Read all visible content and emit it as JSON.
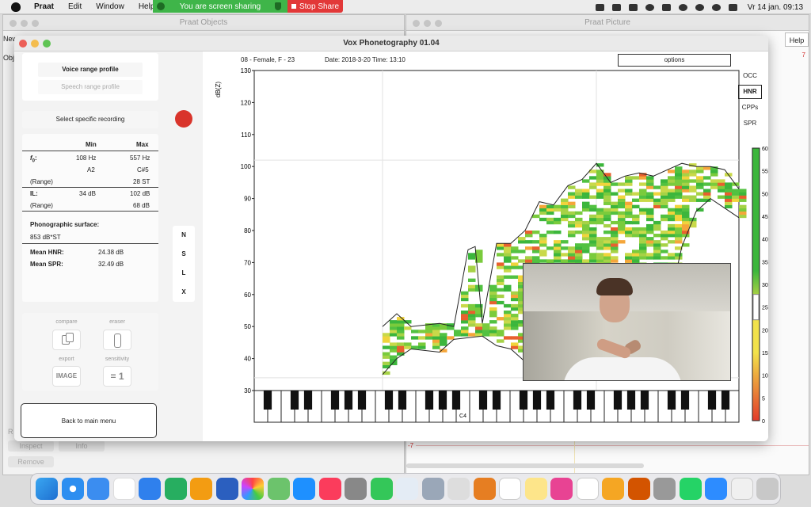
{
  "menubar": {
    "app": "Praat",
    "items": [
      "Edit",
      "Window",
      "Help"
    ],
    "clock": "Vr 14 jan.  09:13"
  },
  "share": {
    "status": "You are screen sharing",
    "stop": "Stop Share"
  },
  "bg_windows": {
    "objects_title": "Praat Objects",
    "picture_title": "Praat Picture",
    "new_label": "New",
    "obj_label": "Obj",
    "help_button": "Help",
    "inspect_button": "Inspect",
    "info_button": "Info",
    "remove_button": "Remove",
    "axis_top": "7",
    "axis_bottom": "-7",
    "partial_label": "R"
  },
  "window": {
    "title": "Vox Phonetography 01.04"
  },
  "left": {
    "voice_range": "Voice range profile",
    "speech_range": "Speech range profile",
    "select_recording": "Select specific recording",
    "table": {
      "col_min": "Min",
      "col_max": "Max",
      "f0_label": "f",
      "f0_sub": "0",
      "f0_colon": ":",
      "f0_min": "108 Hz",
      "f0_max": "557 Hz",
      "note_min": "A2",
      "note_max": "C#5",
      "range_label": "(Range)",
      "f0_range": "28 ST",
      "il_label": "IL:",
      "il_min": "34 dB",
      "il_max": "102 dB",
      "il_range": "68 dB",
      "surface_label": "Phonographic surface:",
      "surface_value": "853 dB*ST",
      "hnr_label": "Mean HNR:",
      "hnr_value": "24.38 dB",
      "spr_label": "Mean SPR:",
      "spr_value": "32.49 dB"
    },
    "tools": {
      "compare": "compare",
      "eraser": "eraser",
      "export": "export",
      "export_value": "IMAGE",
      "sensitivity": "sensitivity",
      "sensitivity_value": "= 1"
    },
    "back": "Back to main menu"
  },
  "modes": [
    "N",
    "S",
    "L",
    "X"
  ],
  "chart_header": {
    "subject": "08  -  Female, F  -  23",
    "date": "Date: 2018-3-20 Time: 13:10",
    "options": "options"
  },
  "metric_buttons": [
    "OCC",
    "HNR",
    "CPPs",
    "SPR"
  ],
  "selected_metric": "HNR",
  "colors": {
    "record": "#d9342b",
    "green": "#3cb63c",
    "yellow": "#f2e24a",
    "red": "#e23b2b"
  },
  "chart_data": {
    "type": "heatmap",
    "ylabel": "dB(Z)",
    "yticks": [
      30,
      40,
      50,
      60,
      70,
      80,
      90,
      100,
      110,
      120,
      130
    ],
    "ylim": [
      30,
      130
    ],
    "xlim_semitones": [
      -12,
      22
    ],
    "piano_label": "C4",
    "upper_contour": [
      [
        -3,
        50
      ],
      [
        -2,
        54
      ],
      [
        -1,
        50
      ],
      [
        1,
        51
      ],
      [
        2,
        50
      ],
      [
        3,
        74
      ],
      [
        3.5,
        75
      ],
      [
        4,
        51
      ],
      [
        5,
        76
      ],
      [
        6,
        76
      ],
      [
        7,
        80
      ],
      [
        8,
        89
      ],
      [
        9,
        88
      ],
      [
        10,
        94
      ],
      [
        11,
        96
      ],
      [
        12,
        101
      ],
      [
        13,
        95
      ],
      [
        14,
        97
      ],
      [
        15,
        98
      ],
      [
        16,
        97
      ],
      [
        17,
        99
      ],
      [
        18,
        101
      ],
      [
        19,
        100
      ],
      [
        20,
        100
      ],
      [
        21,
        99
      ],
      [
        22,
        93
      ]
    ],
    "lower_contour": [
      [
        -3,
        35
      ],
      [
        -2,
        40
      ],
      [
        -1,
        43
      ],
      [
        1,
        42
      ],
      [
        2,
        46
      ],
      [
        4,
        47
      ],
      [
        5,
        44
      ],
      [
        6,
        43
      ],
      [
        7,
        39
      ],
      [
        8,
        37
      ],
      [
        9,
        41
      ],
      [
        10,
        45
      ],
      [
        11,
        47
      ],
      [
        12,
        49
      ],
      [
        13,
        48
      ],
      [
        14,
        46
      ],
      [
        15,
        45
      ],
      [
        16,
        46
      ],
      [
        17,
        55
      ],
      [
        18,
        75
      ],
      [
        19,
        86
      ],
      [
        20,
        90
      ],
      [
        21,
        87
      ],
      [
        22,
        84
      ]
    ],
    "colorbar": {
      "min": 0,
      "max": 60,
      "ticks": [
        0,
        5,
        10,
        15,
        20,
        25,
        30,
        35,
        40,
        45,
        50,
        55,
        60
      ]
    }
  }
}
